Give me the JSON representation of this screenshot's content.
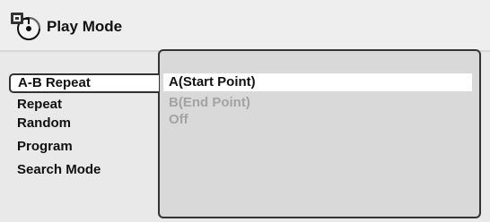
{
  "header": {
    "title": "Play Mode",
    "icon": "disc-settings-icon"
  },
  "menu": {
    "items": [
      {
        "label": "A-B Repeat",
        "selected": true
      },
      {
        "label": "Repeat",
        "selected": false
      },
      {
        "label": "Random",
        "selected": false
      },
      {
        "label": "Program",
        "selected": false
      },
      {
        "label": "Search Mode",
        "selected": false
      }
    ]
  },
  "options": {
    "items": [
      {
        "label": "A(Start Point)",
        "state": "active"
      },
      {
        "label": "B(End Point)",
        "state": "disabled"
      },
      {
        "label": "Off",
        "state": "disabled"
      }
    ]
  },
  "colors": {
    "background": "#e9e9e9",
    "panel": "#d9d9d9",
    "highlight": "#ffffff",
    "disabled_text": "#a3a3a3"
  }
}
